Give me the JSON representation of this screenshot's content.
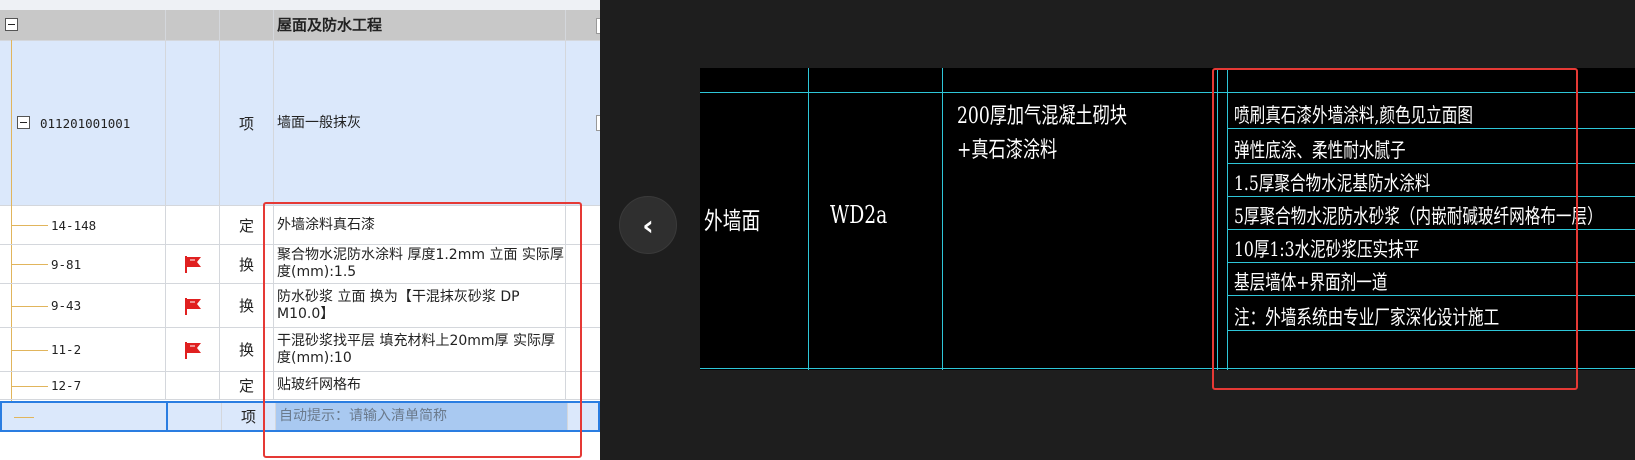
{
  "grid": {
    "section": {
      "name": "屋面及防水工程"
    },
    "item": {
      "code": "011201001001",
      "type": "项",
      "name": "墙面一般抹灰"
    },
    "rows": [
      {
        "code": "14-148",
        "type": "定",
        "name": "外墙涂料真石漆",
        "flag": false
      },
      {
        "code": "9-81",
        "type": "换",
        "name": "聚合物水泥防水涂料 厚度1.2mm 立面 实际厚度(mm):1.5",
        "flag": true
      },
      {
        "code": "9-43",
        "type": "换",
        "name": "防水砂浆 立面  换为【干混抹灰砂浆 DP M10.0】",
        "flag": true
      },
      {
        "code": "11-2",
        "type": "换",
        "name": "干混砂浆找平层 填充材料上20mm厚  实际厚度(mm):10",
        "flag": true
      },
      {
        "code": "12-7",
        "type": "定",
        "name": "贴玻纤网格布",
        "flag": false
      }
    ],
    "new_row": {
      "type": "项",
      "placeholder": "自动提示：请输入清单简称"
    },
    "colors": {
      "flag": "#e02020",
      "selected_row": "#dbe8fb",
      "section_row": "#c8c8c8",
      "highlight_box": "#e53935"
    }
  },
  "cad": {
    "label_wall": "外墙面",
    "label_code": "WD2a",
    "material": [
      "200厚加气混凝土砌块",
      "+真石漆涂料"
    ],
    "layers": [
      "喷刷真石漆外墙涂料,颜色见立面图",
      "弹性底涂、柔性耐水腻子",
      "1.5厚聚合物水泥基防水涂料",
      "5厚聚合物水泥防水砂浆（内嵌耐碱玻纤网格布一层）",
      "10厚1:3水泥砂浆压实抹平",
      "基层墙体+界面剂一道",
      "注：外墙系统由专业厂家深化设计施工"
    ],
    "back_button_icon": "chevron-left-icon",
    "colors": {
      "line": "#2ec6d8",
      "text": "#ffffff"
    }
  }
}
